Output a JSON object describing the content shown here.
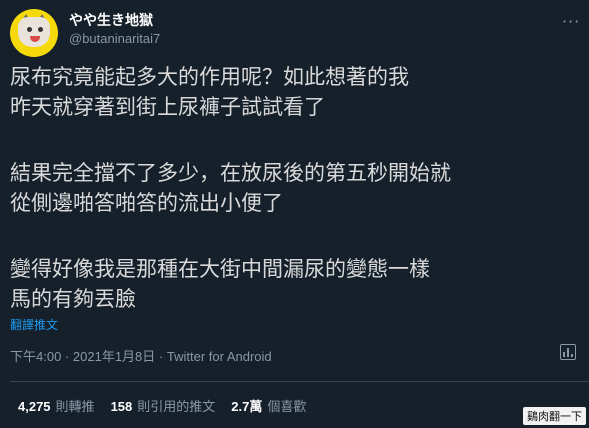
{
  "author": {
    "display_name": "やや生き地獄",
    "handle": "@butaninaritai7"
  },
  "more_label": "···",
  "tweet": {
    "lines": [
      "尿布究竟能起多大的作用呢？如此想著的我",
      "昨天就穿著到街上尿褲子試試看了",
      "",
      "結果完全擋不了多少，在放尿後的第五秒開始就",
      "從側邊啪答啪答的流出小便了",
      "",
      "變得好像我是那種在大街中間漏尿的變態一樣",
      "馬的有夠丟臉"
    ],
    "translate_label": "翻譯推文"
  },
  "meta": {
    "time": "下午4:00",
    "date": "2021年1月8日",
    "separator": "·",
    "source": "Twitter for Android"
  },
  "stats": {
    "retweets": {
      "count": "4,275",
      "label": "則轉推"
    },
    "quotes": {
      "count": "158",
      "label": "則引用的推文"
    },
    "likes": {
      "count": "2.7萬",
      "label": "個喜歡"
    }
  },
  "watermark": "鷄肉翻一下",
  "colors": {
    "background": "#15202b",
    "text": "#d9d9d9",
    "muted": "#8899a6",
    "link": "#1d9bf0",
    "divider": "#38444d"
  }
}
